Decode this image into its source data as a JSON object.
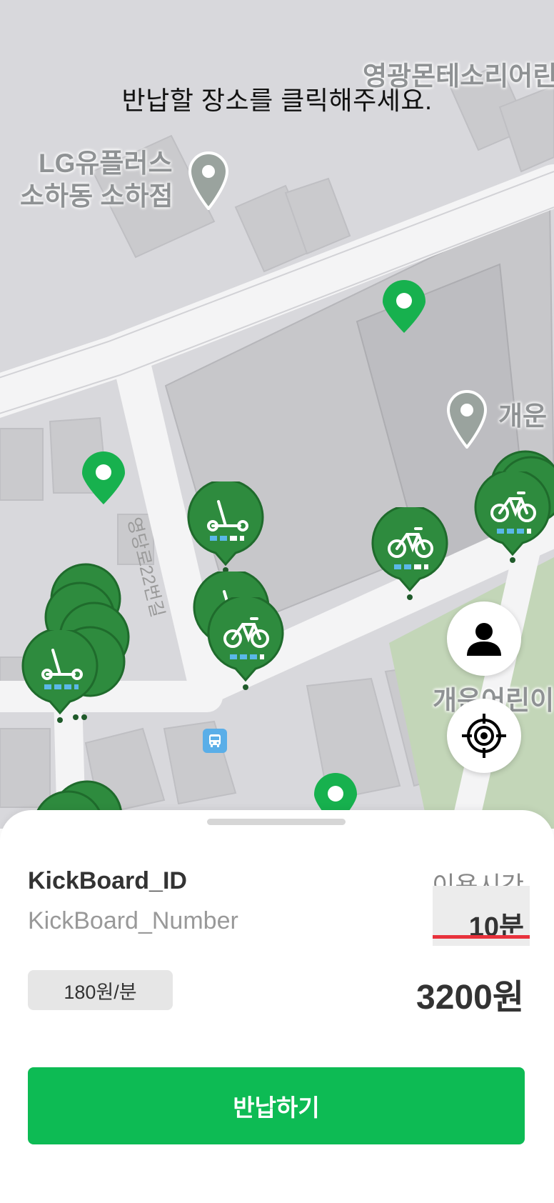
{
  "map": {
    "instruction": "반납할 장소를 클릭해주세요.",
    "labels": {
      "store_line1": "LG유플러스",
      "store_line2": "소하동 소하점",
      "school": "영광몬테소리어린",
      "place_right": "개운",
      "road": "영당로22번길",
      "park": "개운어린이"
    }
  },
  "controls": {
    "profile_icon": "person-icon",
    "location_icon": "crosshair-icon"
  },
  "sheet": {
    "kickboard_id": "KickBoard_ID",
    "kickboard_number": "KickBoard_Number",
    "time_label": "이용시간",
    "time_value": "10분",
    "rate": "180원/분",
    "price": "3200원",
    "return_button": "반납하기"
  },
  "colors": {
    "brand_green": "#0dbb54",
    "marker_green": "#2e8b3e",
    "marker_outline": "#1f6b2c",
    "battery_blue": "#5ab8e8",
    "underline_red": "#e8323c"
  }
}
